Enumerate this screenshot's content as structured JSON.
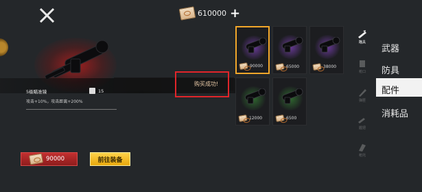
{
  "header": {
    "currency_value": "610000",
    "currency_icon": "cash-icon",
    "add_icon": "plus-icon"
  },
  "item": {
    "name": "5级瞄准镜",
    "weight": "15",
    "description": "攻击+10%，攻击距离+200%"
  },
  "actions": {
    "price": "90000",
    "equip_label": "前往装备"
  },
  "toast": {
    "message": "购买成功!"
  },
  "shop_items": [
    {
      "price": "90000",
      "glow": "#6a3a9a"
    },
    {
      "price": "65000",
      "glow": "#6a3a9a"
    },
    {
      "price": "38000",
      "glow": "#6a3a9a"
    },
    {
      "price": "12000",
      "glow": "#2f6a2f"
    },
    {
      "price": "6500",
      "glow": "#2f6a2f"
    }
  ],
  "category_icons": [
    {
      "label": "瞄具",
      "icon": "scope-icon"
    },
    {
      "label": "枪口",
      "icon": "muzzle-icon"
    },
    {
      "label": "弹匣",
      "icon": "magazine-icon"
    },
    {
      "label": "握把",
      "icon": "grip-icon"
    },
    {
      "label": "枪托",
      "icon": "stock-icon"
    }
  ],
  "tabs": [
    {
      "label": "武器"
    },
    {
      "label": "防具"
    },
    {
      "label": "配件"
    },
    {
      "label": "消耗品"
    }
  ],
  "colors": {
    "selected_border": "#f2a72a",
    "buy_button": "#c23030",
    "equip_button": "#f2c22a",
    "highlight_box": "#e1252a"
  }
}
